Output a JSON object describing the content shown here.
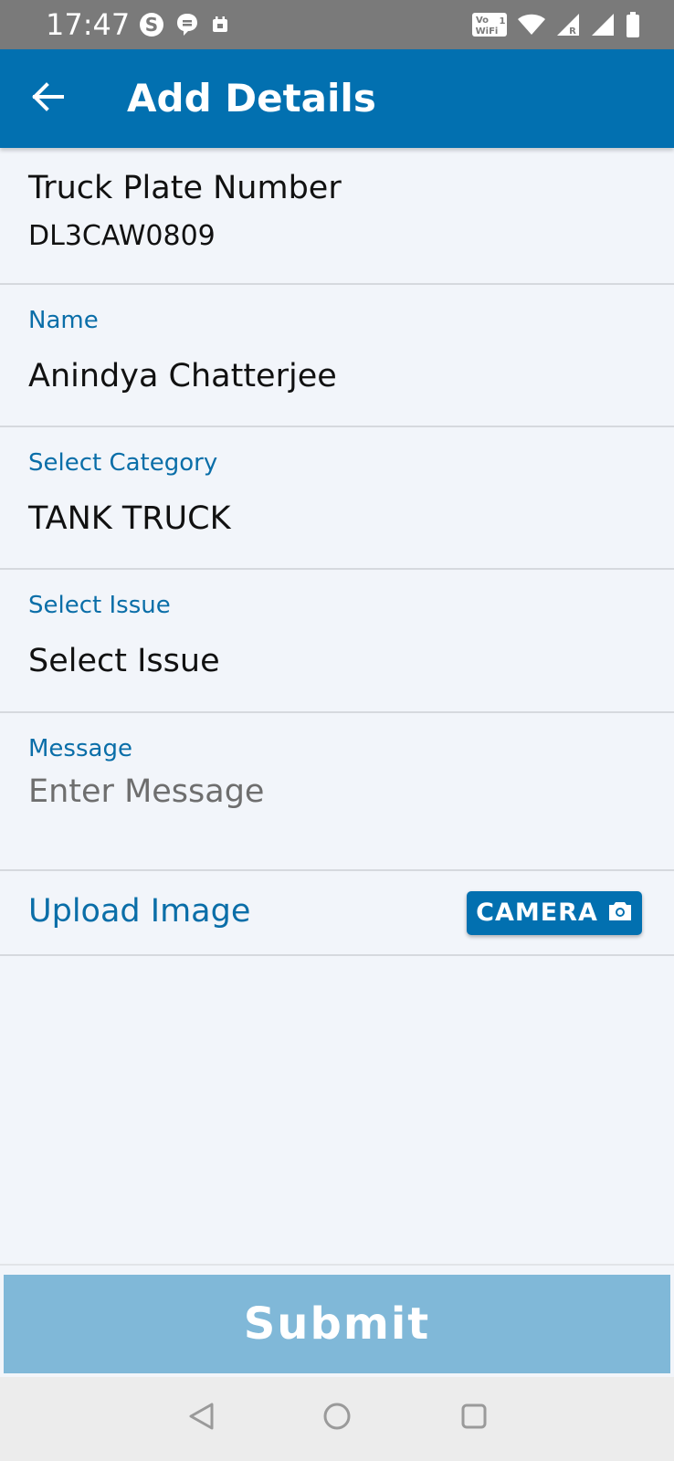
{
  "status_bar": {
    "time": "17:47",
    "left_icons": [
      "skype-icon",
      "chat-icon",
      "calendar-icon"
    ],
    "right_icons": [
      "vowifi-icon",
      "wifi-icon",
      "signal-r-icon",
      "signal-icon",
      "battery-icon"
    ],
    "vowifi_text": "Vo WiFi",
    "background": "#7a7a7a"
  },
  "app_bar": {
    "back_icon": "arrow-left-icon",
    "title": "Add Details",
    "background": "#0270b0"
  },
  "form": {
    "truck_plate": {
      "label": "Truck Plate Number",
      "value": "DL3CAW0809"
    },
    "name": {
      "label": "Name",
      "value": "Anindya Chatterjee"
    },
    "category": {
      "label": "Select Category",
      "value": "TANK TRUCK"
    },
    "issue": {
      "label": "Select Issue",
      "value": "Select Issue"
    },
    "message": {
      "label": "Message",
      "value": "",
      "placeholder": "Enter Message"
    },
    "upload": {
      "label": "Upload Image",
      "camera_button_label": "CAMERA",
      "camera_icon": "camera-icon"
    }
  },
  "submit": {
    "label": "Submit",
    "background": "#80b8d8"
  },
  "nav_bar": {
    "icons": [
      "nav-back-icon",
      "nav-home-icon",
      "nav-recents-icon"
    ]
  },
  "colors": {
    "accent": "#0270b0",
    "label": "#0a6ea8",
    "page_background": "#f2f5fa",
    "divider": "#d6d9de"
  }
}
